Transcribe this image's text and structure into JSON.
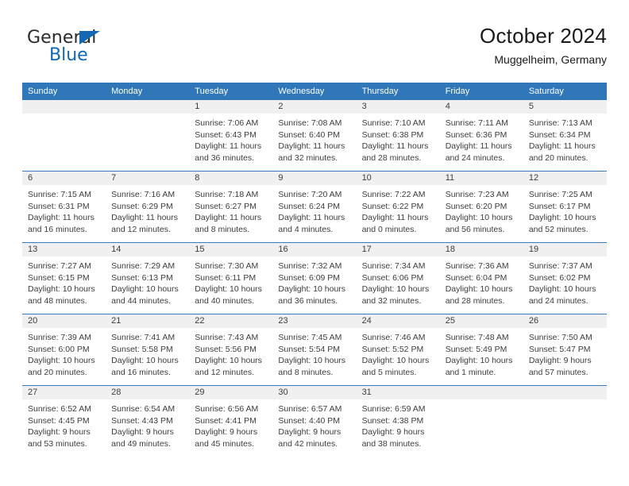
{
  "brand": {
    "word_general": "General",
    "word_blue": "Blue",
    "flag_icon": "triangle-flag-icon",
    "accent_color": "#1268b3"
  },
  "header": {
    "title": "October 2024",
    "subtitle": "Muggelheim, Germany"
  },
  "theme": {
    "header_blue": "#2f77b8",
    "week_divider": "#3a7cbb",
    "date_strip": "#f0f0f0",
    "text": "#3d3d3d"
  },
  "calendar": {
    "weekdays": [
      "Sunday",
      "Monday",
      "Tuesday",
      "Wednesday",
      "Thursday",
      "Friday",
      "Saturday"
    ],
    "weeks": [
      [
        {
          "day": "",
          "lines": []
        },
        {
          "day": "",
          "lines": []
        },
        {
          "day": "1",
          "lines": [
            "Sunrise: 7:06 AM",
            "Sunset: 6:43 PM",
            "Daylight: 11 hours",
            "and 36 minutes."
          ]
        },
        {
          "day": "2",
          "lines": [
            "Sunrise: 7:08 AM",
            "Sunset: 6:40 PM",
            "Daylight: 11 hours",
            "and 32 minutes."
          ]
        },
        {
          "day": "3",
          "lines": [
            "Sunrise: 7:10 AM",
            "Sunset: 6:38 PM",
            "Daylight: 11 hours",
            "and 28 minutes."
          ]
        },
        {
          "day": "4",
          "lines": [
            "Sunrise: 7:11 AM",
            "Sunset: 6:36 PM",
            "Daylight: 11 hours",
            "and 24 minutes."
          ]
        },
        {
          "day": "5",
          "lines": [
            "Sunrise: 7:13 AM",
            "Sunset: 6:34 PM",
            "Daylight: 11 hours",
            "and 20 minutes."
          ]
        }
      ],
      [
        {
          "day": "6",
          "lines": [
            "Sunrise: 7:15 AM",
            "Sunset: 6:31 PM",
            "Daylight: 11 hours",
            "and 16 minutes."
          ]
        },
        {
          "day": "7",
          "lines": [
            "Sunrise: 7:16 AM",
            "Sunset: 6:29 PM",
            "Daylight: 11 hours",
            "and 12 minutes."
          ]
        },
        {
          "day": "8",
          "lines": [
            "Sunrise: 7:18 AM",
            "Sunset: 6:27 PM",
            "Daylight: 11 hours",
            "and 8 minutes."
          ]
        },
        {
          "day": "9",
          "lines": [
            "Sunrise: 7:20 AM",
            "Sunset: 6:24 PM",
            "Daylight: 11 hours",
            "and 4 minutes."
          ]
        },
        {
          "day": "10",
          "lines": [
            "Sunrise: 7:22 AM",
            "Sunset: 6:22 PM",
            "Daylight: 11 hours",
            "and 0 minutes."
          ]
        },
        {
          "day": "11",
          "lines": [
            "Sunrise: 7:23 AM",
            "Sunset: 6:20 PM",
            "Daylight: 10 hours",
            "and 56 minutes."
          ]
        },
        {
          "day": "12",
          "lines": [
            "Sunrise: 7:25 AM",
            "Sunset: 6:17 PM",
            "Daylight: 10 hours",
            "and 52 minutes."
          ]
        }
      ],
      [
        {
          "day": "13",
          "lines": [
            "Sunrise: 7:27 AM",
            "Sunset: 6:15 PM",
            "Daylight: 10 hours",
            "and 48 minutes."
          ]
        },
        {
          "day": "14",
          "lines": [
            "Sunrise: 7:29 AM",
            "Sunset: 6:13 PM",
            "Daylight: 10 hours",
            "and 44 minutes."
          ]
        },
        {
          "day": "15",
          "lines": [
            "Sunrise: 7:30 AM",
            "Sunset: 6:11 PM",
            "Daylight: 10 hours",
            "and 40 minutes."
          ]
        },
        {
          "day": "16",
          "lines": [
            "Sunrise: 7:32 AM",
            "Sunset: 6:09 PM",
            "Daylight: 10 hours",
            "and 36 minutes."
          ]
        },
        {
          "day": "17",
          "lines": [
            "Sunrise: 7:34 AM",
            "Sunset: 6:06 PM",
            "Daylight: 10 hours",
            "and 32 minutes."
          ]
        },
        {
          "day": "18",
          "lines": [
            "Sunrise: 7:36 AM",
            "Sunset: 6:04 PM",
            "Daylight: 10 hours",
            "and 28 minutes."
          ]
        },
        {
          "day": "19",
          "lines": [
            "Sunrise: 7:37 AM",
            "Sunset: 6:02 PM",
            "Daylight: 10 hours",
            "and 24 minutes."
          ]
        }
      ],
      [
        {
          "day": "20",
          "lines": [
            "Sunrise: 7:39 AM",
            "Sunset: 6:00 PM",
            "Daylight: 10 hours",
            "and 20 minutes."
          ]
        },
        {
          "day": "21",
          "lines": [
            "Sunrise: 7:41 AM",
            "Sunset: 5:58 PM",
            "Daylight: 10 hours",
            "and 16 minutes."
          ]
        },
        {
          "day": "22",
          "lines": [
            "Sunrise: 7:43 AM",
            "Sunset: 5:56 PM",
            "Daylight: 10 hours",
            "and 12 minutes."
          ]
        },
        {
          "day": "23",
          "lines": [
            "Sunrise: 7:45 AM",
            "Sunset: 5:54 PM",
            "Daylight: 10 hours",
            "and 8 minutes."
          ]
        },
        {
          "day": "24",
          "lines": [
            "Sunrise: 7:46 AM",
            "Sunset: 5:52 PM",
            "Daylight: 10 hours",
            "and 5 minutes."
          ]
        },
        {
          "day": "25",
          "lines": [
            "Sunrise: 7:48 AM",
            "Sunset: 5:49 PM",
            "Daylight: 10 hours",
            "and 1 minute."
          ]
        },
        {
          "day": "26",
          "lines": [
            "Sunrise: 7:50 AM",
            "Sunset: 5:47 PM",
            "Daylight: 9 hours",
            "and 57 minutes."
          ]
        }
      ],
      [
        {
          "day": "27",
          "lines": [
            "Sunrise: 6:52 AM",
            "Sunset: 4:45 PM",
            "Daylight: 9 hours",
            "and 53 minutes."
          ]
        },
        {
          "day": "28",
          "lines": [
            "Sunrise: 6:54 AM",
            "Sunset: 4:43 PM",
            "Daylight: 9 hours",
            "and 49 minutes."
          ]
        },
        {
          "day": "29",
          "lines": [
            "Sunrise: 6:56 AM",
            "Sunset: 4:41 PM",
            "Daylight: 9 hours",
            "and 45 minutes."
          ]
        },
        {
          "day": "30",
          "lines": [
            "Sunrise: 6:57 AM",
            "Sunset: 4:40 PM",
            "Daylight: 9 hours",
            "and 42 minutes."
          ]
        },
        {
          "day": "31",
          "lines": [
            "Sunrise: 6:59 AM",
            "Sunset: 4:38 PM",
            "Daylight: 9 hours",
            "and 38 minutes."
          ]
        },
        {
          "day": "",
          "lines": []
        },
        {
          "day": "",
          "lines": []
        }
      ]
    ]
  }
}
